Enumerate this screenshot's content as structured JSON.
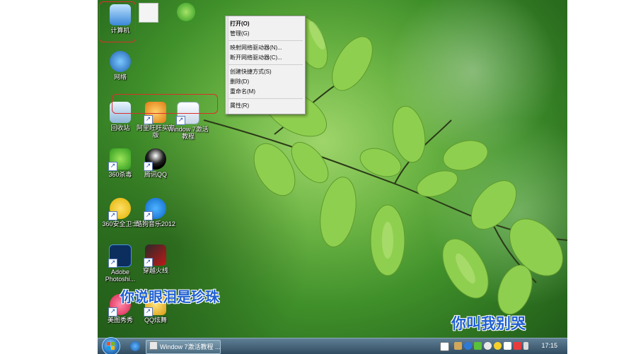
{
  "context_menu": {
    "items": [
      "打开(O)",
      "管理(G)",
      "映射网络驱动器(N)...",
      "断开网络驱动器(C)...",
      "创建快捷方式(S)",
      "删除(D)",
      "重命名(M)",
      "属性(R)"
    ]
  },
  "desktop": {
    "icons": [
      "计算机",
      "网络",
      "回收站",
      "阿里旺旺买家版",
      "Window 7激活教程",
      "360杀毒",
      "腾讯QQ",
      "360安全卫士",
      "酷狗音乐2012",
      "Adobe Photoshi...",
      "穿越火线",
      "美图秀秀",
      "QQ炫舞"
    ]
  },
  "lyrics": {
    "line1": "你说眼泪是珍珠",
    "line2": "你叫我别哭"
  },
  "taskbar": {
    "window_button": "Window 7激活教程 ...",
    "clock": "17:15"
  },
  "colors": {
    "highlight": "#d9302c",
    "lyric_text": "#1f5fd1"
  }
}
